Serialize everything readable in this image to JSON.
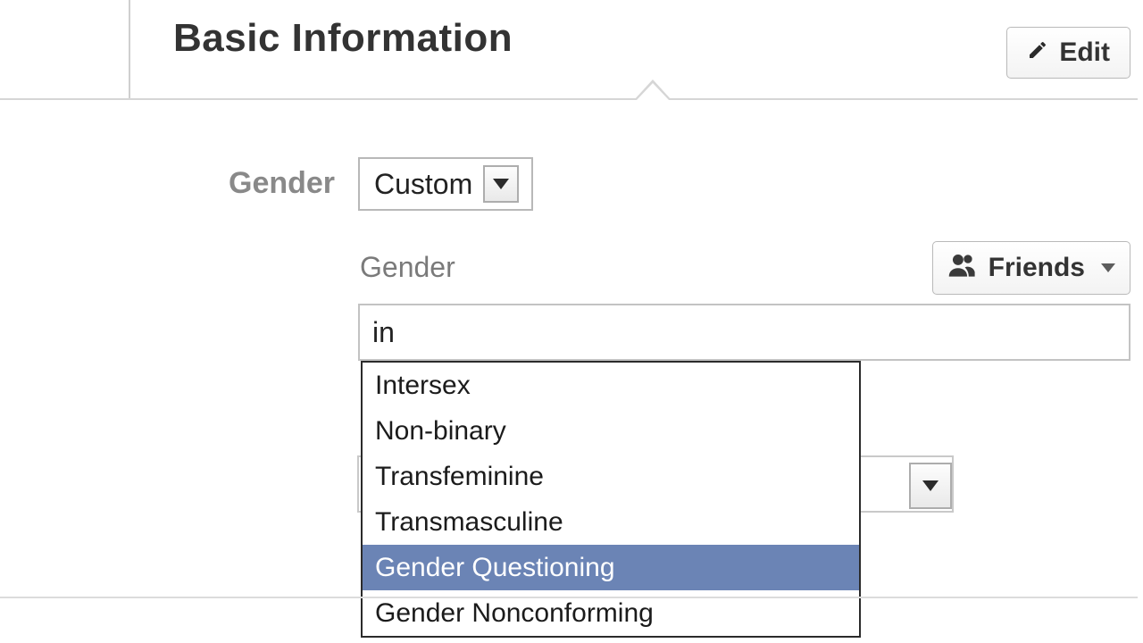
{
  "section": {
    "title": "Basic Information",
    "edit_label": "Edit"
  },
  "gender_row": {
    "label": "Gender",
    "select_value": "Custom"
  },
  "custom_gender": {
    "sub_label": "Gender",
    "input_value": "in",
    "privacy_label": "Friends",
    "options": [
      "Intersex",
      "Non-binary",
      "Transfeminine",
      "Transmasculine",
      "Gender Questioning",
      "Gender Nonconforming"
    ],
    "highlighted_index": 4
  }
}
